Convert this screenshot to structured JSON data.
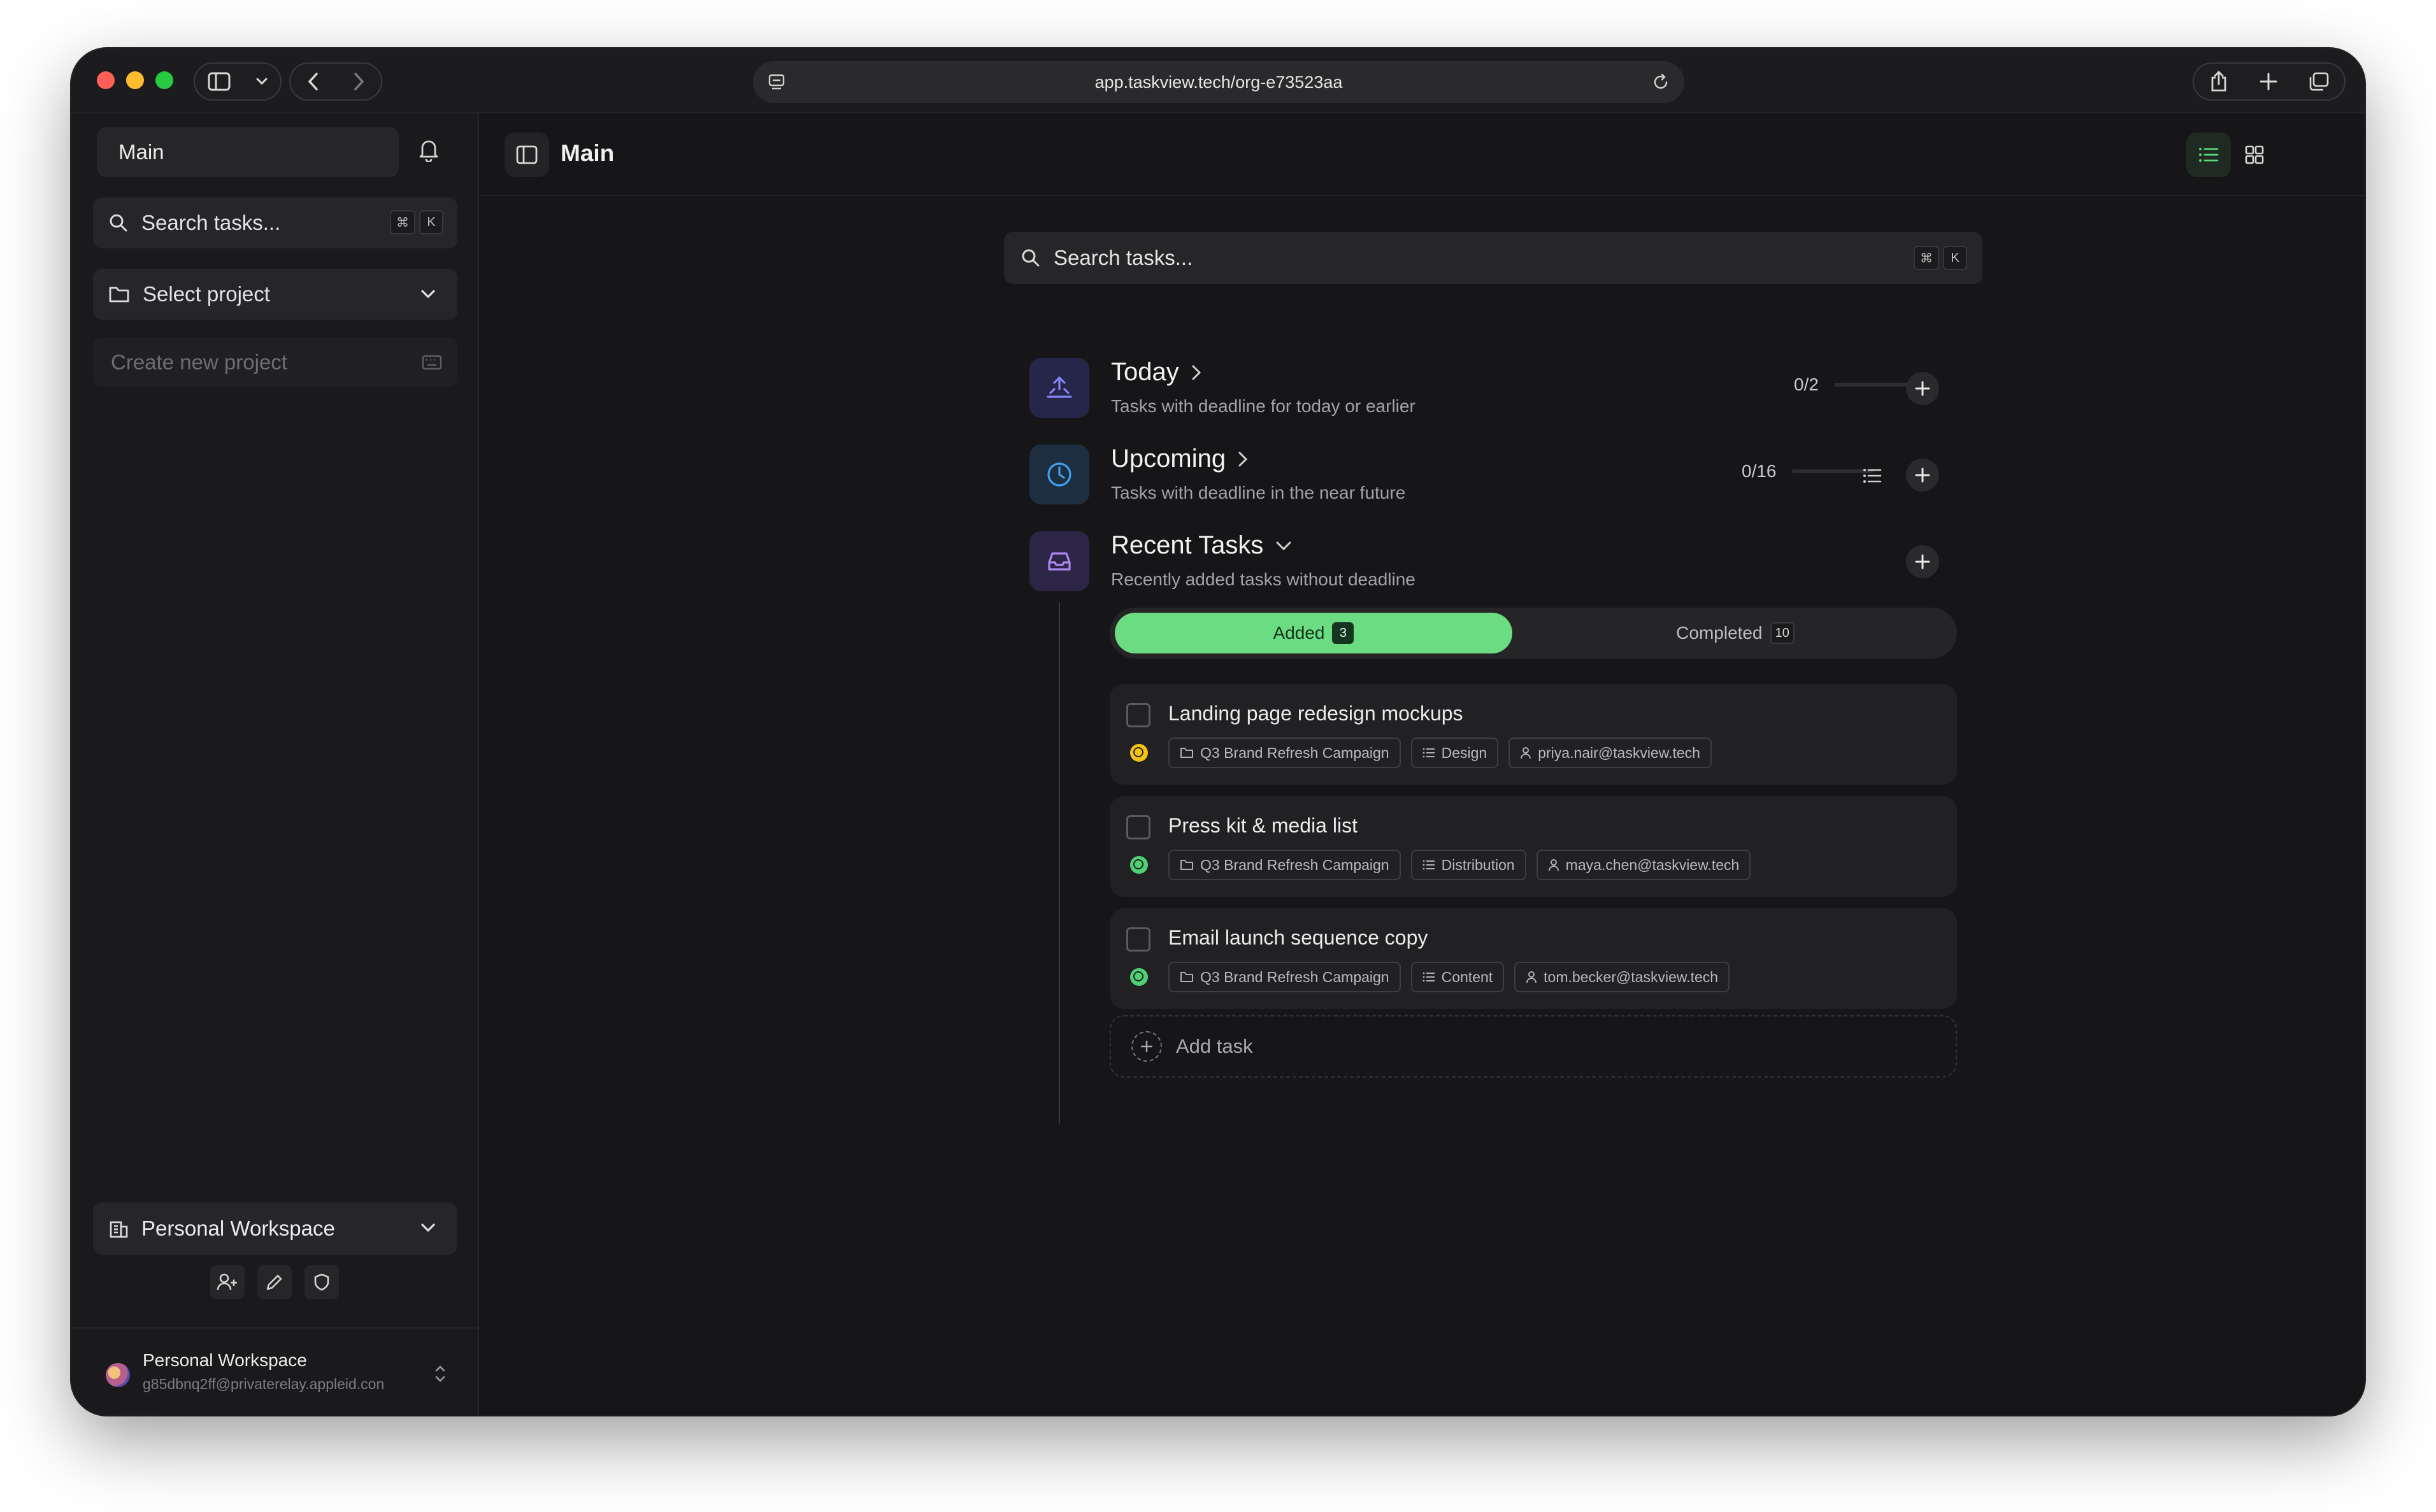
{
  "browser": {
    "url": "app.taskview.tech/org-e73523aa"
  },
  "sidebar": {
    "main_label": "Main",
    "search_placeholder": "Search tasks...",
    "shortcut": [
      "⌘",
      "K"
    ],
    "project_select": "Select project",
    "create_project_placeholder": "Create new project",
    "workspace_select": "Personal Workspace",
    "user": {
      "name": "Personal Workspace",
      "email": "g85dbnq2ff@privaterelay.appleid.con"
    }
  },
  "header": {
    "title": "Main"
  },
  "content": {
    "search_placeholder": "Search tasks...",
    "shortcut": [
      "⌘",
      "K"
    ],
    "sections": [
      {
        "title": "Today",
        "subtitle": "Tasks with deadline for today or earlier",
        "progress_text": "0/2",
        "progress_fraction": 0
      },
      {
        "title": "Upcoming",
        "subtitle": "Tasks with deadline in the near future",
        "progress_text": "0/16",
        "progress_fraction": 0
      },
      {
        "title": "Recent Tasks",
        "subtitle": "Recently added tasks without deadline"
      }
    ],
    "tabs": {
      "added_label": "Added",
      "added_count": "3",
      "completed_label": "Completed",
      "completed_count": "10",
      "active": "Added"
    },
    "tasks": [
      {
        "title": "Landing page redesign mockups",
        "status_color": "#f5c214",
        "project": "Q3 Brand Refresh Campaign",
        "list": "Design",
        "assignee": "priya.nair@taskview.tech"
      },
      {
        "title": "Press kit & media list",
        "status_color": "#4fd071",
        "project": "Q3 Brand Refresh Campaign",
        "list": "Distribution",
        "assignee": "maya.chen@taskview.tech"
      },
      {
        "title": "Email launch sequence copy",
        "status_color": "#4fd071",
        "project": "Q3 Brand Refresh Campaign",
        "list": "Content",
        "assignee": "tom.becker@taskview.tech"
      }
    ],
    "add_task_label": "Add task"
  },
  "colors": {
    "accent": "#6cdc82",
    "today_icon": "#7b7bf5",
    "upcoming_icon": "#3fa0f0",
    "recent_icon": "#a987f5"
  }
}
